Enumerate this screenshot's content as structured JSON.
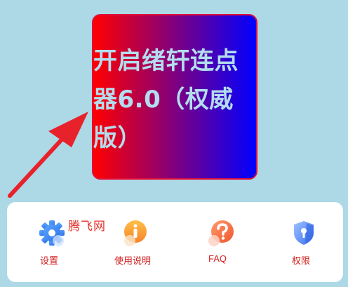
{
  "hero": {
    "title": "开启绪轩连点器6.0（权威版）"
  },
  "watermark": "腾飞网",
  "menu": {
    "items": [
      {
        "label": "设置",
        "icon": "gear-icon"
      },
      {
        "label": "使用说明",
        "icon": "info-icon"
      },
      {
        "label": "FAQ",
        "icon": "question-icon"
      },
      {
        "label": "权限",
        "icon": "shield-lock-icon"
      }
    ]
  },
  "colors": {
    "background": "#add8e6",
    "hero_gradient_start": "#ff0000",
    "hero_gradient_end": "#0000ff",
    "label_red": "#d51f1f",
    "arrow_red": "#e8222b"
  }
}
